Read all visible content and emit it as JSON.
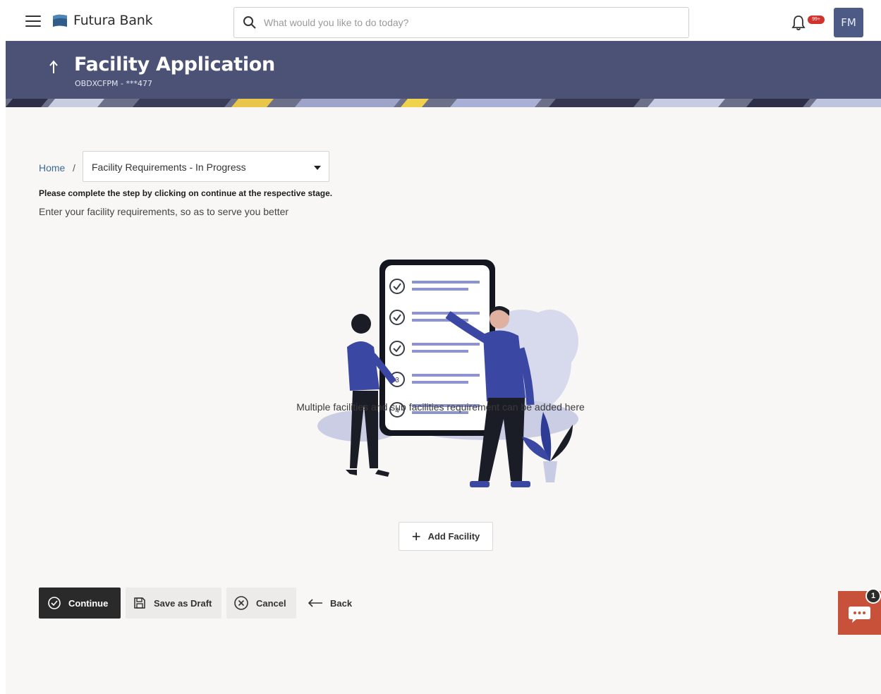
{
  "brand": {
    "name": "Futura Bank"
  },
  "search": {
    "placeholder": "What would you like to do today?"
  },
  "notifications": {
    "badge": "99+"
  },
  "user": {
    "initials": "FM"
  },
  "header": {
    "title": "Facility Application",
    "subtitle": "OBDXCFPM - ***477"
  },
  "breadcrumb": {
    "home": "Home",
    "separator": "/",
    "stage_selected": "Facility Requirements - In Progress"
  },
  "instruction": "Please complete the step by clicking on continue at the respective stage.",
  "subtext": "Enter your facility requirements, so as to serve you better",
  "illustration": {
    "steps": [
      "3",
      "4"
    ]
  },
  "facility_note": "Multiple facilities and sub facilities requirement can be added here",
  "add_facility_label": "Add Facility",
  "actions": {
    "continue": "Continue",
    "save_draft": "Save as Draft",
    "cancel": "Cancel",
    "back": "Back"
  },
  "chat": {
    "badge": "1"
  },
  "colors": {
    "banner": "#4b5275",
    "avatar": "#4d5a85",
    "accent": "#3a47a3",
    "continue": "#2a2a2a",
    "chat": "#c8513a",
    "alert": "#d2322d"
  }
}
